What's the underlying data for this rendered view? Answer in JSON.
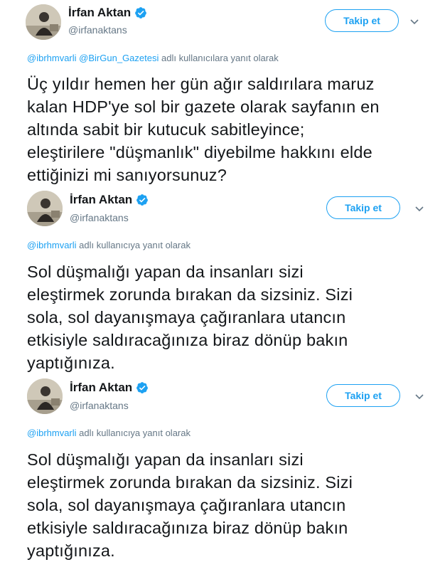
{
  "tweets": [
    {
      "display_name": "İrfan Aktan",
      "handle": "@irfanaktans",
      "follow_label": "Takip et",
      "reply_mentions": [
        "@ibrhmvarli",
        "@BirGun_Gazetesi"
      ],
      "reply_suffix": "adlı kullanıcılara yanıt olarak",
      "text_lines": [
        "Üç yıldır hemen her gün ağır saldırılara maruz",
        "kalan HDP'ye sol bir gazete olarak sayfanın en",
        "altında sabit bir kutucuk sabitleyince;",
        "eleştirilere \"düşmanlık\" diyebilme hakkını elde",
        "ettiğinizi mi sanıyorsunuz?"
      ]
    },
    {
      "display_name": "İrfan Aktan",
      "handle": "@irfanaktans",
      "follow_label": "Takip et",
      "reply_mentions": [
        "@ibrhmvarli"
      ],
      "reply_suffix": "adlı kullanıcıya yanıt olarak",
      "text_lines": [
        "Sol düşmalığı yapan da insanları sizi",
        "eleştirmek zorunda bırakan da sizsiniz. Sizi",
        "sola, sol dayanışmaya çağıranlara utancın",
        "etkisiyle saldıracağınıza biraz dönüp bakın",
        "yaptığınıza."
      ]
    },
    {
      "display_name": "İrfan Aktan",
      "handle": "@irfanaktans",
      "follow_label": "Takip et",
      "reply_mentions": [
        "@ibrhmvarli"
      ],
      "reply_suffix": "adlı kullanıcıya yanıt olarak",
      "text_lines": [
        "Sol düşmalığı yapan da insanları sizi",
        "eleştirmek zorunda bırakan da sizsiniz. Sizi",
        "sola, sol dayanışmaya çağıranlara utancın",
        "etkisiyle saldıracağınıza biraz dönüp bakın",
        "yaptığınıza."
      ]
    }
  ],
  "colors": {
    "accent": "#1da1f2",
    "secondary_text": "#657786",
    "primary_text": "#14171a"
  },
  "icons": [
    "verified-badge-icon",
    "chevron-down-icon"
  ]
}
